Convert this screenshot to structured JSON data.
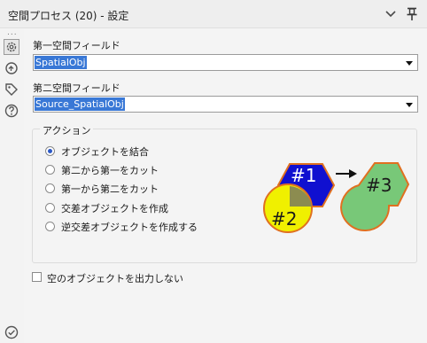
{
  "window": {
    "title": "空間プロセス (20) - 設定"
  },
  "sidebar": {
    "dots": "...",
    "items": [
      {
        "name": "configuration-icon"
      },
      {
        "name": "annotation-icon"
      },
      {
        "name": "tag-icon"
      },
      {
        "name": "help-icon"
      }
    ],
    "status": "checkmark-icon"
  },
  "form": {
    "first_label": "第一空間フィールド",
    "first_value": "SpatialObj",
    "second_label": "第二空間フィールド",
    "second_value": "Source_SpatialObj"
  },
  "action": {
    "title": "アクション",
    "options": [
      {
        "label": "オブジェクトを結合",
        "selected": true
      },
      {
        "label": "第二から第一をカット",
        "selected": false
      },
      {
        "label": "第一から第二をカット",
        "selected": false
      },
      {
        "label": "交差オブジェクトを作成",
        "selected": false
      },
      {
        "label": "逆交差オブジェクトを作成する",
        "selected": false
      }
    ]
  },
  "diagram": {
    "shape1": "#1",
    "shape2": "#2",
    "shape3": "#3"
  },
  "checkbox": {
    "label": "空のオブジェクトを出力しない",
    "checked": false
  },
  "colors": {
    "selection": "#3978d6",
    "hexagon": "#1010d0",
    "circle": "#f0f000",
    "result": "#78c878",
    "outline": "#e07020"
  }
}
